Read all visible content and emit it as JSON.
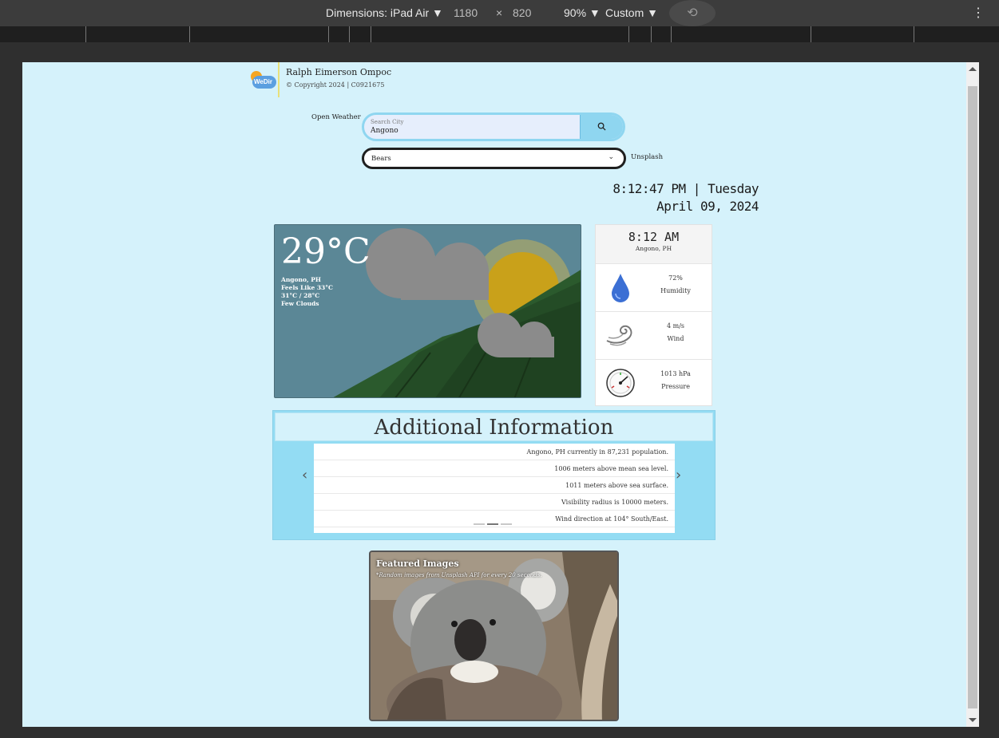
{
  "devtools": {
    "device_label": "Dimensions: iPad Air ▼",
    "width": "1180",
    "times": "×",
    "height": "820",
    "zoom": "90% ▼",
    "throttle": "Custom ▼",
    "more": "⋮"
  },
  "brand": {
    "logo_text": "WeDir",
    "name": "Ralph Eimerson Ompoc",
    "copyright": "© Copyright 2024 | C0921675"
  },
  "search": {
    "provider_label": "Open Weather",
    "placeholder": "Search City",
    "value": "Angono"
  },
  "image_select": {
    "value": "Bears",
    "chevron": "⌄",
    "provider_label": "Unsplash"
  },
  "clock": {
    "time_day": "8:12:47 PM | Tuesday",
    "date": "April 09, 2024"
  },
  "weather": {
    "temp": "29°C",
    "location": "Angono, PH",
    "feels_like": "Feels Like 33°C",
    "hi_lo": "31°C / 28°C",
    "condition": "Few Clouds"
  },
  "stats": {
    "local_time": "8:12 AM",
    "local_location": "Angono, PH",
    "humidity_value": "72%",
    "humidity_label": "Humidity",
    "wind_value": "4 m/s",
    "wind_label": "Wind",
    "pressure_value": "1013 hPa",
    "pressure_label": "Pressure"
  },
  "additional": {
    "title": "Additional Information",
    "items": [
      "Angono, PH currently in 87,231 population.",
      "1006 meters above mean sea level.",
      "1011 meters above sea surface.",
      "Visibility radius is 10000 meters.",
      "Wind direction at 104° South/East."
    ],
    "prev": "‹",
    "next": "›"
  },
  "featured": {
    "title": "Featured Images",
    "subtitle": "*Random images from Unsplash API for every 20 seconds."
  }
}
